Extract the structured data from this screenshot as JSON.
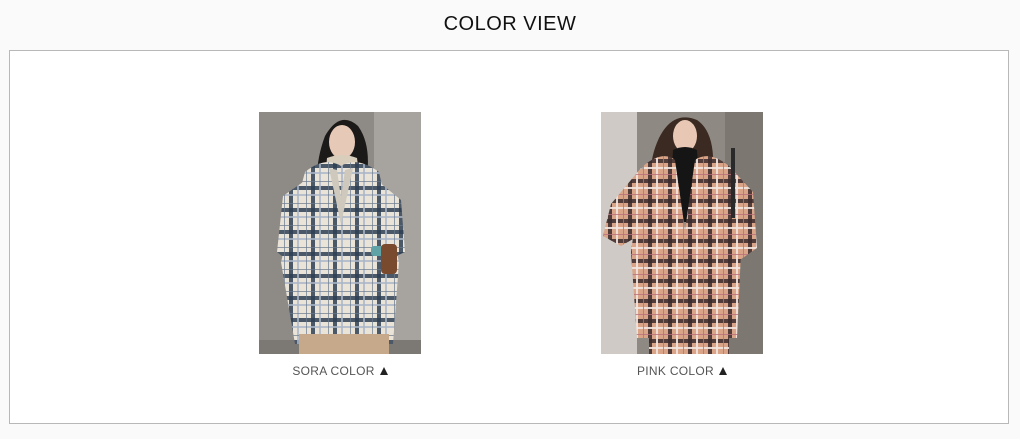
{
  "section": {
    "title": "COLOR VIEW"
  },
  "items": [
    {
      "caption": "SORA COLOR",
      "arrow_icon": "triangle-up-icon"
    },
    {
      "caption": "PINK COLOR",
      "arrow_icon": "triangle-up-icon"
    }
  ],
  "colors": {
    "background": "#fafafa",
    "frame_border": "#b8b8b8",
    "sora_jacket": "#e7e1d6",
    "pink_jacket": "#d7a38c"
  }
}
